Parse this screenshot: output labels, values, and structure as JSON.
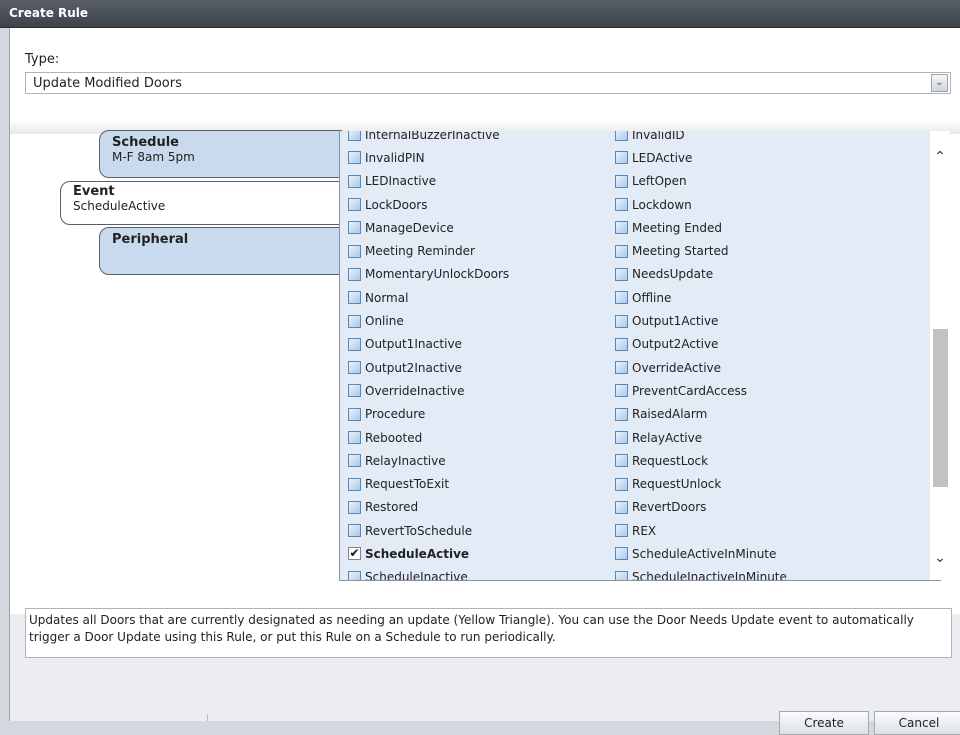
{
  "window": {
    "title": "Create Rule"
  },
  "type_field": {
    "label": "Type:",
    "value": "Update Modified Doors"
  },
  "cards": {
    "schedule": {
      "title": "Schedule",
      "subtitle": "M-F 8am 5pm"
    },
    "event": {
      "title": "Event",
      "subtitle": "ScheduleActive"
    },
    "peripheral": {
      "title": "Peripheral"
    }
  },
  "events_left": [
    {
      "label": "InternalBuzzerInactive",
      "checked": false
    },
    {
      "label": "InvalidPIN",
      "checked": false
    },
    {
      "label": "LEDInactive",
      "checked": false
    },
    {
      "label": "LockDoors",
      "checked": false
    },
    {
      "label": "ManageDevice",
      "checked": false
    },
    {
      "label": "Meeting Reminder",
      "checked": false
    },
    {
      "label": "MomentaryUnlockDoors",
      "checked": false
    },
    {
      "label": "Normal",
      "checked": false
    },
    {
      "label": "Online",
      "checked": false
    },
    {
      "label": "Output1Inactive",
      "checked": false
    },
    {
      "label": "Output2Inactive",
      "checked": false
    },
    {
      "label": "OverrideInactive",
      "checked": false
    },
    {
      "label": "Procedure",
      "checked": false
    },
    {
      "label": "Rebooted",
      "checked": false
    },
    {
      "label": "RelayInactive",
      "checked": false
    },
    {
      "label": "RequestToExit",
      "checked": false
    },
    {
      "label": "Restored",
      "checked": false
    },
    {
      "label": "RevertToSchedule",
      "checked": false
    },
    {
      "label": "ScheduleActive",
      "checked": true
    },
    {
      "label": "ScheduleInactive",
      "checked": false
    }
  ],
  "events_right": [
    {
      "label": "InvalidID",
      "checked": false
    },
    {
      "label": "LEDActive",
      "checked": false
    },
    {
      "label": "LeftOpen",
      "checked": false
    },
    {
      "label": "Lockdown",
      "checked": false
    },
    {
      "label": "Meeting Ended",
      "checked": false
    },
    {
      "label": "Meeting Started",
      "checked": false
    },
    {
      "label": "NeedsUpdate",
      "checked": false
    },
    {
      "label": "Offline",
      "checked": false
    },
    {
      "label": "Output1Active",
      "checked": false
    },
    {
      "label": "Output2Active",
      "checked": false
    },
    {
      "label": "OverrideActive",
      "checked": false
    },
    {
      "label": "PreventCardAccess",
      "checked": false
    },
    {
      "label": "RaisedAlarm",
      "checked": false
    },
    {
      "label": "RelayActive",
      "checked": false
    },
    {
      "label": "RequestLock",
      "checked": false
    },
    {
      "label": "RequestUnlock",
      "checked": false
    },
    {
      "label": "RevertDoors",
      "checked": false
    },
    {
      "label": "REX",
      "checked": false
    },
    {
      "label": "ScheduleActiveInMinute",
      "checked": false
    },
    {
      "label": "ScheduleInactiveInMinute",
      "checked": false
    }
  ],
  "description": "Updates all Doors that are currently designated as needing an update (Yellow Triangle). You can use the Door Needs Update event to automatically trigger a Door Update using this Rule, or put this Rule on a Schedule to run periodically.",
  "buttons": {
    "create": "Create",
    "cancel": "Cancel"
  },
  "icons": {
    "dropdown": "chevron-down-icon",
    "scroll_up": "chevron-up-icon",
    "scroll_down": "chevron-down-icon",
    "checkmark": "checkmark-icon"
  }
}
